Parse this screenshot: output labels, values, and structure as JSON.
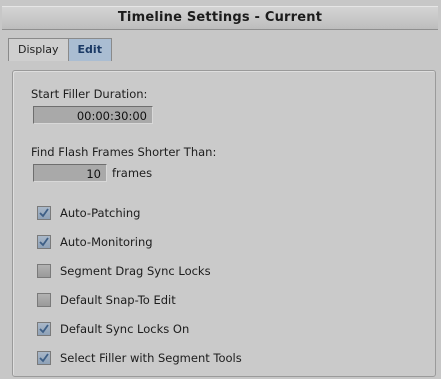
{
  "window": {
    "title": "Timeline Settings - Current"
  },
  "tabs": [
    {
      "label": "Display",
      "active": false
    },
    {
      "label": "Edit",
      "active": true
    }
  ],
  "start_filler": {
    "label": "Start Filler Duration:",
    "value": "00:00:30:00"
  },
  "flash_frames": {
    "label": "Find Flash Frames Shorter Than:",
    "value": "10",
    "unit": "frames"
  },
  "options": [
    {
      "label": "Auto-Patching",
      "checked": true
    },
    {
      "label": "Auto-Monitoring",
      "checked": true
    },
    {
      "label": "Segment Drag Sync Locks",
      "checked": false
    },
    {
      "label": "Default Snap-To Edit",
      "checked": false
    },
    {
      "label": "Default Sync Locks On",
      "checked": true
    },
    {
      "label": "Select Filler with Segment Tools",
      "checked": true
    }
  ]
}
